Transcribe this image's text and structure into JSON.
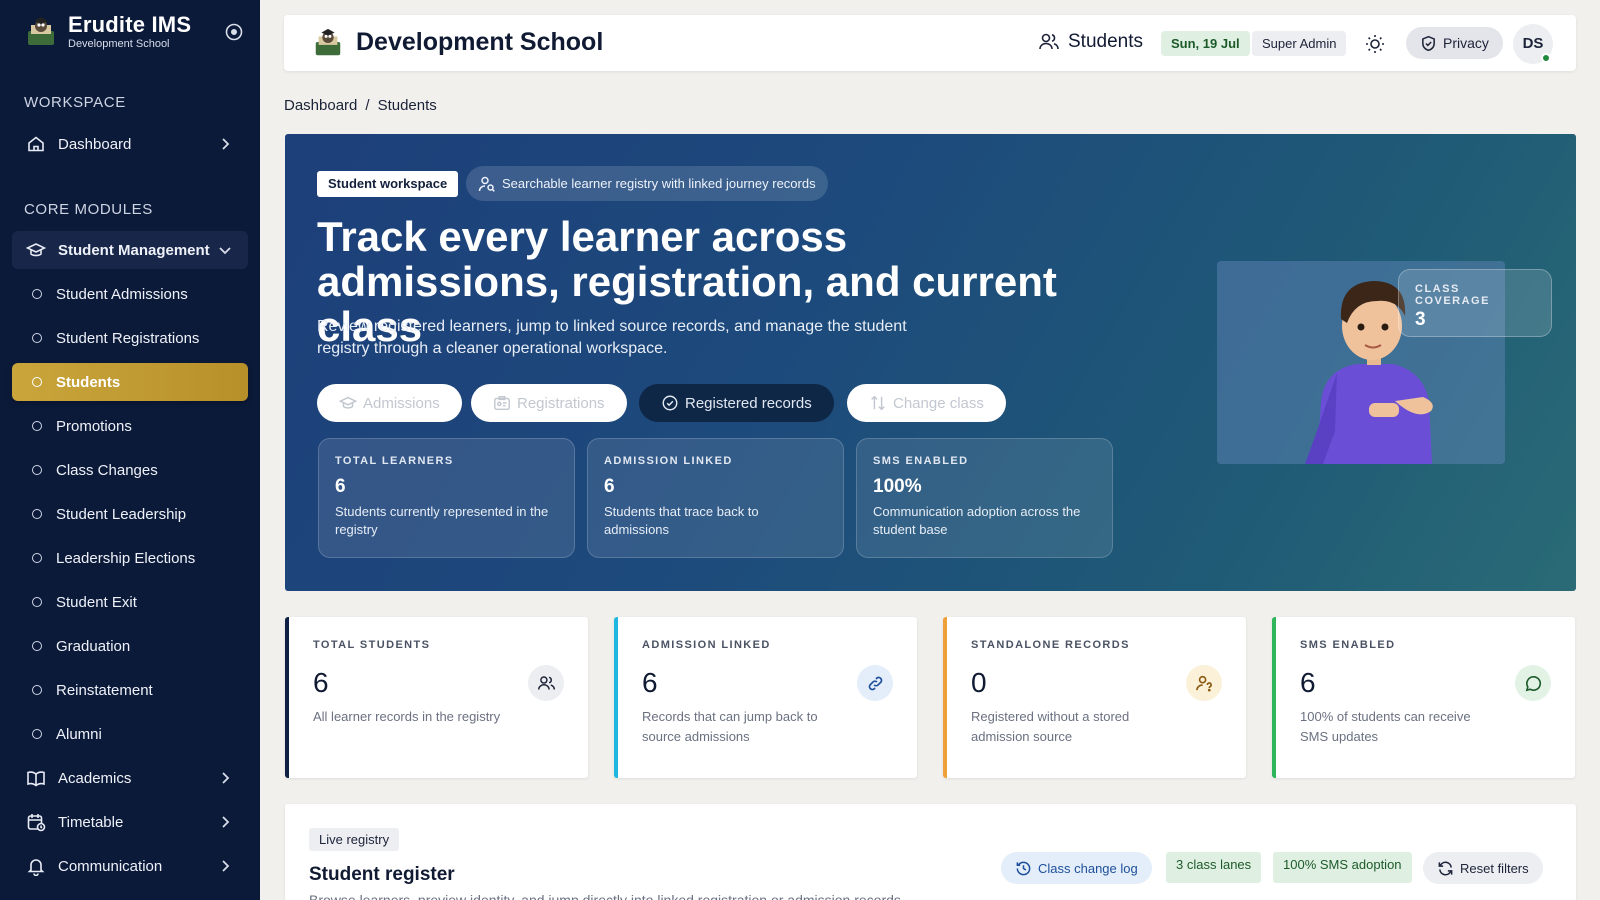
{
  "sidebar": {
    "app_name": "Erudite IMS",
    "app_subtitle": "Development School",
    "section_workspace": "WORKSPACE",
    "dashboard": "Dashboard",
    "section_core": "CORE MODULES",
    "group_label": "Student Management",
    "sub_items": [
      "Student Admissions",
      "Student Registrations",
      "Students",
      "Promotions",
      "Class Changes",
      "Student Leadership",
      "Leadership Elections",
      "Student Exit",
      "Graduation",
      "Reinstatement",
      "Alumni"
    ],
    "active_item": "Students",
    "bottom_items": [
      "Academics",
      "Timetable",
      "Communication"
    ]
  },
  "topbar": {
    "school_name": "Development School",
    "page_label": "Students",
    "date": "Sun, 19 Jul",
    "role": "Super Admin",
    "privacy_label": "Privacy",
    "avatar_initials": "DS"
  },
  "breadcrumb": {
    "root": "Dashboard",
    "separator": "/",
    "current": "Students"
  },
  "hero": {
    "tag": "Student workspace",
    "pill": "Searchable learner registry with linked journey records",
    "title": "Track every learner across admissions, registration, and current class",
    "description": "Review registered learners, jump to linked source records, and manage the student registry through a cleaner operational workspace.",
    "buttons": [
      "Admissions",
      "Registrations",
      "Registered records",
      "Change class"
    ],
    "stats": [
      {
        "label": "TOTAL LEARNERS",
        "value": "6",
        "desc": "Students currently represented in the registry"
      },
      {
        "label": "ADMISSION LINKED",
        "value": "6",
        "desc": "Students that trace back to admissions"
      },
      {
        "label": "SMS ENABLED",
        "value": "100%",
        "desc": "Communication adoption across the student base"
      }
    ],
    "coverage_label": "CLASS COVERAGE",
    "coverage_value": "3"
  },
  "kpis": [
    {
      "label": "TOTAL STUDENTS",
      "value": "6",
      "desc": "All learner records in the registry",
      "accent": "#0f1f45",
      "icon": "users-icon"
    },
    {
      "label": "ADMISSION LINKED",
      "value": "6",
      "desc": "Records that can jump back to source admissions",
      "accent": "#1fb6e0",
      "icon": "link-icon"
    },
    {
      "label": "STANDALONE RECORDS",
      "value": "0",
      "desc": "Registered without a stored admission source",
      "accent": "#f0a03a",
      "icon": "user-question-icon"
    },
    {
      "label": "SMS ENABLED",
      "value": "6",
      "desc": "100% of students can receive SMS updates",
      "accent": "#2fb65a",
      "icon": "message-icon"
    }
  ],
  "register": {
    "tag": "Live registry",
    "title": "Student register",
    "subtitle": "Browse learners, preview identity, and jump directly into linked registration or admission records.",
    "class_log": "Class change log",
    "lanes": "3 class lanes",
    "sms_adoption": "100% SMS adoption",
    "reset": "Reset filters"
  },
  "colors": {
    "sidebar_bg": "#0c1a3a",
    "active_gold": "#c9a53b",
    "hero_blue": "#1d3f7a"
  }
}
